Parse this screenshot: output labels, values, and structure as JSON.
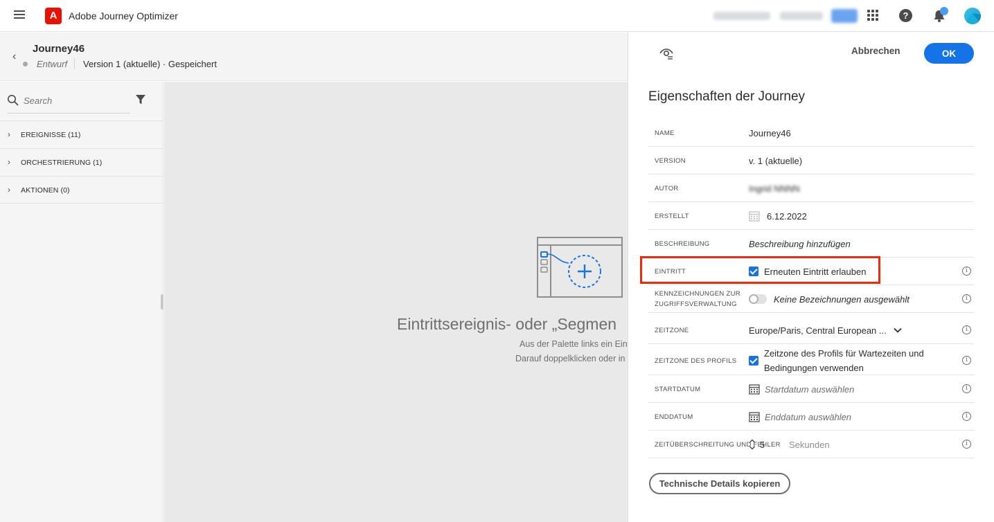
{
  "topbar": {
    "app_title": "Adobe Journey Optimizer",
    "logo_letter": "A",
    "help_glyph": "?"
  },
  "journey": {
    "name": "Journey46",
    "status": "Entwurf",
    "version": "Version 1 (aktuelle) · Gespeichert"
  },
  "palette": {
    "search_placeholder": "Search",
    "sections": [
      {
        "label": "EREIGNISSE (11)"
      },
      {
        "label": "ORCHESTRIERUNG (1)"
      },
      {
        "label": "AKTIONEN (0)"
      }
    ]
  },
  "canvas": {
    "title": "Eintrittsereignis- oder „Segmen",
    "line1": "Aus der Palette links ein Eintr",
    "line2": "Darauf doppelklicken oder in"
  },
  "panel": {
    "cancel_label": "Abbrechen",
    "ok_label": "OK",
    "title": "Eigenschaften der Journey",
    "copy_label": "Technische Details kopieren",
    "info_glyph": "i",
    "rows": {
      "name": {
        "label": "NAME",
        "value": "Journey46"
      },
      "version": {
        "label": "VERSION",
        "value": "v. 1 (aktuelle)"
      },
      "author": {
        "label": "AUTOR",
        "value": "Ingrid NNNN"
      },
      "created": {
        "label": "ERSTELLT",
        "value": "6.12.2022"
      },
      "description": {
        "label": "BESCHREIBUNG",
        "value": "Beschreibung hinzufügen"
      },
      "entry": {
        "label": "EINTRITT",
        "value": "Erneuten Eintritt erlauben",
        "checked": true
      },
      "access": {
        "label": "KENNZEICHNUNGEN ZUR ZUGRIFFSVERWALTUNG",
        "value": "Keine Bezeichnungen ausgewählt",
        "enabled": false
      },
      "timezone": {
        "label": "ZEITZONE",
        "value": "Europe/Paris, Central European ..."
      },
      "profile_tz": {
        "label": "ZEITZONE DES PROFILS",
        "value": "Zeitzone des Profils für Wartezeiten und Bedingungen verwenden",
        "checked": true
      },
      "start": {
        "label": "STARTDATUM",
        "value": "Startdatum auswählen"
      },
      "end": {
        "label": "ENDDATUM",
        "value": "Enddatum auswählen"
      },
      "timeout": {
        "label": "ZEITÜBERSCHREITUNG UND FEHLER",
        "value": "5",
        "unit": "Sekunden"
      }
    }
  }
}
